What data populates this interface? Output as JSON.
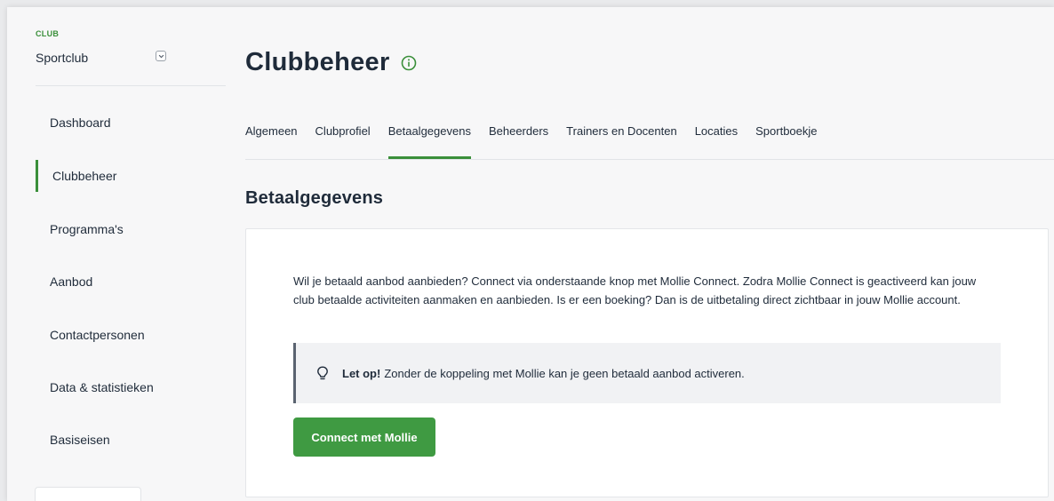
{
  "sidebar": {
    "club_label": "CLUB",
    "club_name": "Sportclub",
    "items": [
      {
        "label": "Dashboard"
      },
      {
        "label": "Clubbeheer"
      },
      {
        "label": "Programma's"
      },
      {
        "label": "Aanbod"
      },
      {
        "label": "Contactpersonen"
      },
      {
        "label": "Data & statistieken"
      },
      {
        "label": "Basiseisen"
      }
    ],
    "active_item": "Clubbeheer"
  },
  "page": {
    "title": "Clubbeheer",
    "tabs": [
      {
        "label": "Algemeen"
      },
      {
        "label": "Clubprofiel"
      },
      {
        "label": "Betaalgegevens"
      },
      {
        "label": "Beheerders"
      },
      {
        "label": "Trainers en Docenten"
      },
      {
        "label": "Locaties"
      },
      {
        "label": "Sportboekje"
      }
    ],
    "active_tab": "Betaalgegevens",
    "section_title": "Betaalgegevens",
    "description": "Wil je betaald aanbod aanbieden? Connect via onderstaande knop met Mollie Connect. Zodra Mollie Connect is geactiveerd kan jouw club betaalde activiteiten aanmaken en aanbieden. Is er een boeking? Dan is de uitbetaling direct zichtbaar in jouw Mollie account.",
    "notice": {
      "strong": "Let op!",
      "text": "Zonder de koppeling met Mollie kan je geen betaald aanbod activeren."
    },
    "connect_button": "Connect met Mollie"
  },
  "colors": {
    "accent": "#3a8f3a",
    "button": "#3f9a42",
    "text": "#1f2b3a",
    "notice_bg": "#f1f2f4"
  },
  "icons": [
    "chevron-down-icon",
    "info-icon",
    "lightbulb-icon"
  ]
}
